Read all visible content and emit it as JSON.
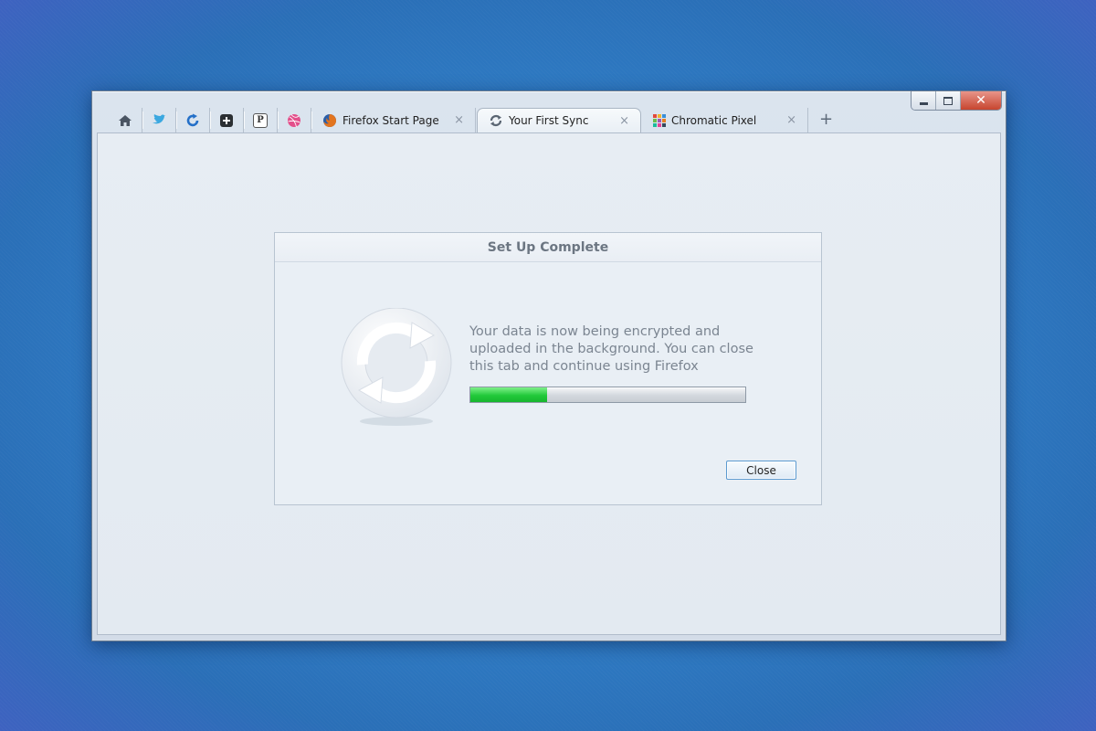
{
  "window": {
    "controls": {
      "minimize_icon": "minimize-icon",
      "maximize_icon": "maximize-icon",
      "close_icon": "close-icon"
    }
  },
  "tabs": {
    "app_tabs": [
      {
        "icon": "home-icon"
      },
      {
        "icon": "twitter-icon"
      },
      {
        "icon": "refresh-icon"
      },
      {
        "icon": "plus-app-icon"
      },
      {
        "icon": "p-app-icon",
        "glyph": "P"
      },
      {
        "icon": "dribbble-icon"
      }
    ],
    "items": [
      {
        "label": "Firefox Start Page",
        "icon": "firefox-icon",
        "close": "×"
      },
      {
        "label": "Your First Sync",
        "icon": "sync-icon",
        "close": "×",
        "active": true
      },
      {
        "label": "Chromatic Pixel",
        "icon": "chromatic-pixel-icon",
        "close": "×"
      }
    ],
    "new_tab": "+"
  },
  "dialog": {
    "title": "Set Up Complete",
    "message": "Your data is now being encrypted and uploaded in the background. You can close this tab and continue using Firefox",
    "progress_percent": 28,
    "close_label": "Close"
  },
  "colors": {
    "desktop": "#2f7dc6",
    "progress_green": "#22c93a",
    "close_red": "#c7452f"
  }
}
